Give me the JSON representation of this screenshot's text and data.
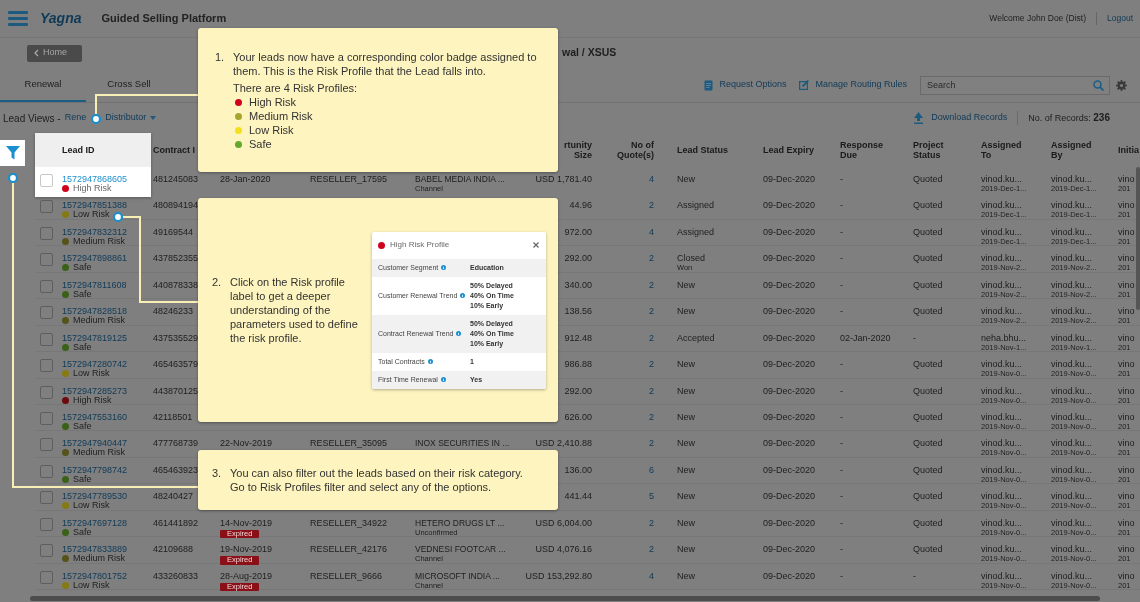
{
  "header": {
    "logo": "Yagna",
    "title": "Guided Selling Platform",
    "welcome": "Welcome John Doe (Dist)",
    "logout": "Logout"
  },
  "subbar": {
    "home_button": "Home",
    "breadcrumb": "wal / XSUS"
  },
  "tabs": [
    {
      "label": "Renewal",
      "selected": true
    },
    {
      "label": "Cross Sell",
      "selected": false
    }
  ],
  "toolbar": {
    "actions": [
      {
        "label": "Request Options",
        "kind": "options"
      },
      {
        "label": "Manage Routing Rules",
        "kind": "rules"
      }
    ],
    "search": {
      "placeholder": "Search"
    }
  },
  "lead_views": {
    "label": "Lead Views -",
    "view": "Rene",
    "dropdown": "Distributor"
  },
  "records": {
    "download": "Download Records",
    "count": "No. of Records: **236**"
  },
  "table": {
    "headers": {
      "lead_id": "Lead ID",
      "contract_id": "Contract I",
      "opportunity": "rtunity Size",
      "quotes": "No of Quote(s)",
      "status": "Lead Status",
      "expiry": "Lead Expiry",
      "response_due": "Response Due",
      "project_status": "Project Status",
      "assigned_to": "Assigned To",
      "assigned_by": "Assigned By",
      "initial": "Initia"
    },
    "rows": [
      {
        "checked": false,
        "highlighted": true,
        "lead_id": "1572947868605",
        "risk": {
          "label": "High Risk",
          "color": "#d0021b"
        },
        "contract_id": "481245083",
        "date": "28-Jan-2020",
        "reseller": "RESELLER_17595",
        "customer": "BABEL MEDIA INDIA ...",
        "customer_type": "Channel",
        "opportunity": "USD 1,781.40",
        "quotes": "4",
        "status": "New",
        "expiry": "09-Dec-2020",
        "response_due": "-",
        "project_status": "Quoted",
        "assigned_to": {
          "name": "vinod.ku...",
          "date": "2019-Dec-1..."
        },
        "assigned_by": {
          "name": "vinod.ku...",
          "date": "2019-Dec-1..."
        },
        "initial": {
          "name": "vino",
          "date": "201"
        }
      },
      {
        "checked": false,
        "highlighted": false,
        "lead_id": "1572947851388",
        "risk": {
          "label": "Low Risk",
          "color": "#867a12"
        },
        "contract_id": "480894194",
        "opportunity": "44.96",
        "quotes": "2",
        "status": "Assigned",
        "expiry": "09-Dec-2020",
        "response_due": "-",
        "project_status": "Quoted",
        "assigned_to": {
          "name": "vinod.ku...",
          "date": "2019-Dec-1..."
        },
        "assigned_by": {
          "name": "vinod.ku...",
          "date": "2019-Dec-1..."
        },
        "initial": {
          "name": "vino",
          "date": "201"
        }
      },
      {
        "checked": false,
        "highlighted": false,
        "lead_id": "1572947832312",
        "risk": {
          "label": "Medium Risk",
          "color": "#55531a"
        },
        "contract_id": "49169544",
        "opportunity": "972.00",
        "quotes": "4",
        "status": "Assigned",
        "expiry": "09-Dec-2020",
        "response_due": "-",
        "project_status": "Quoted",
        "assigned_to": {
          "name": "vinod.ku...",
          "date": "2019-Dec-1..."
        },
        "assigned_by": {
          "name": "vinod.ku...",
          "date": "2019-Dec-1..."
        },
        "initial": {
          "name": "vino",
          "date": "201"
        }
      },
      {
        "checked": false,
        "highlighted": false,
        "lead_id": "1572947898861",
        "risk": {
          "label": "Safe",
          "color": "#3b6119"
        },
        "contract_id": "437852355",
        "opportunity": "292.00",
        "quotes": "2",
        "status": "Closed",
        "status_note": "Won",
        "expiry": "09-Dec-2020",
        "response_due": "-",
        "project_status": "Quoted",
        "assigned_to": {
          "name": "vinod.ku...",
          "date": "2019-Nov-2..."
        },
        "assigned_by": {
          "name": "vinod.ku...",
          "date": "2019-Nov-2..."
        },
        "initial": {
          "name": "vino",
          "date": "201"
        }
      },
      {
        "checked": false,
        "highlighted": false,
        "lead_id": "1572947811608",
        "risk": {
          "label": "Safe",
          "color": "#3b6119"
        },
        "contract_id": "440878338",
        "opportunity": "340.00",
        "quotes": "2",
        "status": "New",
        "expiry": "09-Dec-2020",
        "response_due": "-",
        "project_status": "Quoted",
        "assigned_to": {
          "name": "vinod.ku...",
          "date": "2019-Nov-2..."
        },
        "assigned_by": {
          "name": "vinod.ku...",
          "date": "2019-Nov-2..."
        },
        "initial": {
          "name": "vino",
          "date": "201"
        }
      },
      {
        "checked": false,
        "highlighted": false,
        "lead_id": "1572947828518",
        "risk": {
          "label": "Medium Risk",
          "color": "#55531a"
        },
        "contract_id": "48246233",
        "opportunity": "138.56",
        "quotes": "2",
        "status": "New",
        "expiry": "09-Dec-2020",
        "response_due": "-",
        "project_status": "Quoted",
        "assigned_to": {
          "name": "vinod.ku...",
          "date": "2019-Nov-2..."
        },
        "assigned_by": {
          "name": "vinod.ku...",
          "date": "2019-Nov-2..."
        },
        "initial": {
          "name": "vino",
          "date": "201"
        }
      },
      {
        "checked": false,
        "highlighted": false,
        "lead_id": "1572947819125",
        "risk": {
          "label": "Safe",
          "color": "#3b6119"
        },
        "contract_id": "437535529",
        "opportunity": "912.48",
        "quotes": "2",
        "status": "Accepted",
        "expiry": "09-Dec-2020",
        "response_due": "02-Jan-2020",
        "project_status": "-",
        "assigned_to": {
          "name": "neha.bhu...",
          "date": "2019-Nov-1..."
        },
        "assigned_by": {
          "name": "vinod.ku...",
          "date": "2019-Nov-1..."
        },
        "initial": {
          "name": "vino",
          "date": "201"
        }
      },
      {
        "checked": false,
        "highlighted": false,
        "lead_id": "1572947280742",
        "risk": {
          "label": "Low Risk",
          "color": "#867a12"
        },
        "contract_id": "465463579",
        "opportunity": "986.88",
        "quotes": "2",
        "status": "New",
        "expiry": "09-Dec-2020",
        "response_due": "-",
        "project_status": "Quoted",
        "assigned_to": {
          "name": "vinod.ku...",
          "date": "2019-Nov-0..."
        },
        "assigned_by": {
          "name": "vinod.ku...",
          "date": "2019-Nov-0..."
        },
        "initial": {
          "name": "vino",
          "date": "201"
        }
      },
      {
        "checked": false,
        "highlighted": false,
        "lead_id": "1572947285273",
        "risk": {
          "label": "High Risk",
          "color": "#6b0a0f"
        },
        "contract_id": "443870125",
        "opportunity": "292.00",
        "quotes": "2",
        "status": "New",
        "expiry": "09-Dec-2020",
        "response_due": "-",
        "project_status": "Quoted",
        "assigned_to": {
          "name": "vinod.ku...",
          "date": "2019-Nov-0..."
        },
        "assigned_by": {
          "name": "vinod.ku...",
          "date": "2019-Nov-0..."
        },
        "initial": {
          "name": "vino",
          "date": "201"
        }
      },
      {
        "checked": false,
        "highlighted": false,
        "lead_id": "1572947553160",
        "risk": {
          "label": "Safe",
          "color": "#3b6119"
        },
        "contract_id": "42118501",
        "opportunity": "626.00",
        "quotes": "2",
        "status": "New",
        "expiry": "09-Dec-2020",
        "response_due": "-",
        "project_status": "Quoted",
        "assigned_to": {
          "name": "vinod.ku...",
          "date": "2019-Nov-0..."
        },
        "assigned_by": {
          "name": "vinod.ku...",
          "date": "2019-Nov-0..."
        },
        "initial": {
          "name": "vino",
          "date": "201"
        }
      },
      {
        "checked": false,
        "highlighted": false,
        "lead_id": "1572947940447",
        "risk": {
          "label": "Medium Risk",
          "color": "#55531a"
        },
        "contract_id": "477768739",
        "date": "22-Nov-2019",
        "reseller": "RESELLER_35095",
        "customer": "INOX SECURITIES IN ...",
        "opportunity": "USD 2,410.88",
        "quotes": "2",
        "status": "New",
        "expiry": "09-Dec-2020",
        "response_due": "-",
        "project_status": "Quoted",
        "assigned_to": {
          "name": "vinod.ku...",
          "date": "2019-Nov-0..."
        },
        "assigned_by": {
          "name": "vinod.ku...",
          "date": "2019-Nov-0..."
        },
        "initial": {
          "name": "vino",
          "date": "201"
        }
      },
      {
        "checked": false,
        "highlighted": false,
        "lead_id": "1572947798742",
        "risk": {
          "label": "Safe",
          "color": "#3b6119"
        },
        "contract_id": "465463923",
        "opportunity": "136.00",
        "quotes": "6",
        "status": "New",
        "expiry": "09-Dec-2020",
        "response_due": "-",
        "project_status": "Quoted",
        "assigned_to": {
          "name": "vinod.ku...",
          "date": "2019-Nov-0..."
        },
        "assigned_by": {
          "name": "vinod.ku...",
          "date": "2019-Nov-0..."
        },
        "initial": {
          "name": "vino",
          "date": "201"
        }
      },
      {
        "checked": false,
        "highlighted": false,
        "lead_id": "1572947789530",
        "risk": {
          "label": "Low Risk",
          "color": "#867a12"
        },
        "contract_id": "48240427",
        "opportunity": "441.44",
        "quotes": "5",
        "status": "New",
        "expiry": "09-Dec-2020",
        "response_due": "-",
        "project_status": "Quoted",
        "assigned_to": {
          "name": "vinod.ku...",
          "date": "2019-Nov-0..."
        },
        "assigned_by": {
          "name": "vinod.ku...",
          "date": "2019-Nov-0..."
        },
        "initial": {
          "name": "vino",
          "date": "201"
        }
      },
      {
        "checked": false,
        "highlighted": false,
        "lead_id": "1572947697128",
        "risk": {
          "label": "Safe",
          "color": "#3b6119"
        },
        "contract_id": "461441892",
        "date": "14-Nov-2019",
        "badge": "Expired",
        "reseller": "RESELLER_34922",
        "customer": "HETERO DRUGS LT ...",
        "customer_type": "Unconfirmed",
        "opportunity": "USD 6,004.00",
        "quotes": "2",
        "status": "New",
        "expiry": "09-Dec-2020",
        "response_due": "-",
        "project_status": "Quoted",
        "assigned_to": {
          "name": "vinod.ku...",
          "date": "2019-Nov-0..."
        },
        "assigned_by": {
          "name": "vinod.ku...",
          "date": "2019-Nov-0..."
        },
        "initial": {
          "name": "vino",
          "date": "201"
        }
      },
      {
        "checked": false,
        "highlighted": false,
        "lead_id": "1572947833889",
        "risk": {
          "label": "Medium Risk",
          "color": "#55531a"
        },
        "contract_id": "42109688",
        "date": "19-Nov-2019",
        "badge": "Expired",
        "reseller": "RESELLER_42176",
        "customer": "VEDNESI FOOTCAR ...",
        "customer_type": "Channel",
        "opportunity": "USD 4,076.16",
        "quotes": "2",
        "status": "New",
        "expiry": "09-Dec-2020",
        "response_due": "-",
        "project_status": "Quoted",
        "assigned_to": {
          "name": "vinod.ku...",
          "date": "2019-Nov-0..."
        },
        "assigned_by": {
          "name": "vinod.ku...",
          "date": "2019-Nov-0..."
        },
        "initial": {
          "name": "vino",
          "date": "201"
        }
      },
      {
        "checked": false,
        "highlighted": false,
        "lead_id": "1572947801752",
        "risk": {
          "label": "Low Risk",
          "color": "#867a12"
        },
        "contract_id": "433260833",
        "date": "28-Aug-2019",
        "badge": "Expired",
        "reseller": "RESELLER_9666",
        "customer": "MICROSOFT INDIA ...",
        "customer_type": "Channel",
        "opportunity": "USD 153,292.80",
        "quotes": "4",
        "status": "New",
        "expiry": "09-Dec-2020",
        "response_due": "-",
        "project_status": "-",
        "assigned_to": {
          "name": "vinod.ku...",
          "date": "2019-Nov-0..."
        },
        "assigned_by": {
          "name": "vinod.ku...",
          "date": "2019-Nov-0..."
        },
        "initial": {
          "name": "vino",
          "date": "201"
        }
      }
    ]
  },
  "tour": {
    "steps": [
      {
        "number": "1.",
        "text": "Your leads now have a corresponding color badge assigned to them. This is the Risk Profile that the Lead falls into.",
        "note": "There are 4 Risk Profiles:",
        "legend": [
          {
            "label": "High Risk",
            "color": "#d0021b"
          },
          {
            "label": "Medium Risk",
            "color": "#a5a52e"
          },
          {
            "label": "Low Risk",
            "color": "#f4df1e"
          },
          {
            "label": "Safe",
            "color": "#64a82e"
          }
        ]
      },
      {
        "number": "2.",
        "text": "Click on the Risk profile label to get a deeper understanding of the parameters used to define the risk profile.",
        "profile_card": {
          "title": "High Risk Profile",
          "color": "#d0021b",
          "rows": [
            {
              "label": "Customer Segment",
              "values": [
                "Education"
              ]
            },
            {
              "label": "Customer Renewal Trend",
              "values": [
                "50% Delayed",
                "40% On Time",
                "10% Early"
              ]
            },
            {
              "label": "Contract Renewal Trend",
              "values": [
                "50% Delayed",
                "40% On Time",
                "10% Early"
              ]
            },
            {
              "label": "Total Contracts",
              "values": [
                "1"
              ]
            },
            {
              "label": "First Time Renewal",
              "values": [
                "Yes"
              ]
            }
          ]
        }
      },
      {
        "number": "3.",
        "text": "You can also filter out the leads based on their risk category. Go to Risk Profiles filter and select any of the options."
      }
    ]
  }
}
